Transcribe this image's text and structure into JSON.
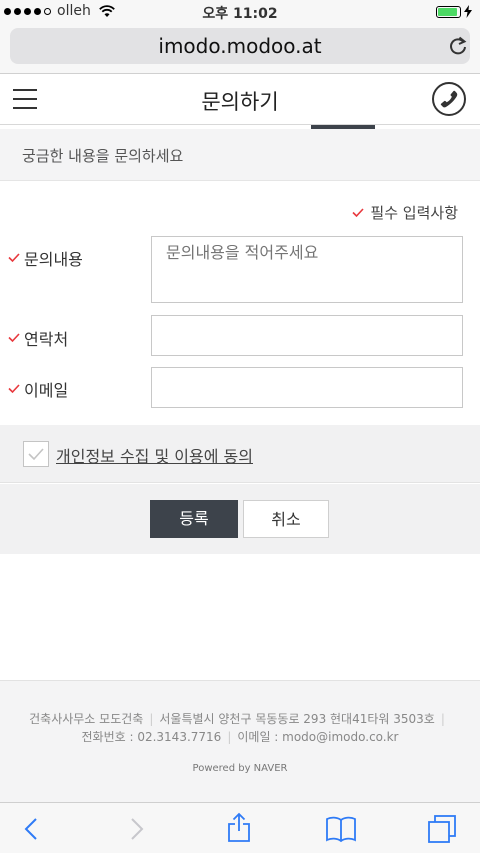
{
  "status_bar": {
    "carrier": "olleh",
    "time": "오후 11:02",
    "battery": 0.9
  },
  "browser": {
    "url": "imodo.modoo.at"
  },
  "header": {
    "title": "문의하기"
  },
  "subheader": {
    "text": "궁금한 내용을 문의하세요"
  },
  "form": {
    "required_note": "필수 입력사항",
    "inquiry_label": "문의내용",
    "inquiry_placeholder": "문의내용을 적어주세요",
    "contact_label": "연락처",
    "contact_value": "",
    "email_label": "이메일",
    "email_value": "",
    "agree_label": "개인정보 수집 및 이용에 동의",
    "submit_label": "등록",
    "cancel_label": "취소"
  },
  "footer": {
    "company": "건축사사무소 모도건축",
    "address": "서울특별시 양천구 목동동로 293 현대41타워 3503호",
    "phone": "전화번호 : 02.3143.7716",
    "email": "이메일 : modo@imodo.co.kr",
    "powered": "Powered by NAVER"
  },
  "colors": {
    "accent_dark": "#3d434b",
    "check_red": "#e8383d",
    "battery_green": "#4cd964"
  }
}
